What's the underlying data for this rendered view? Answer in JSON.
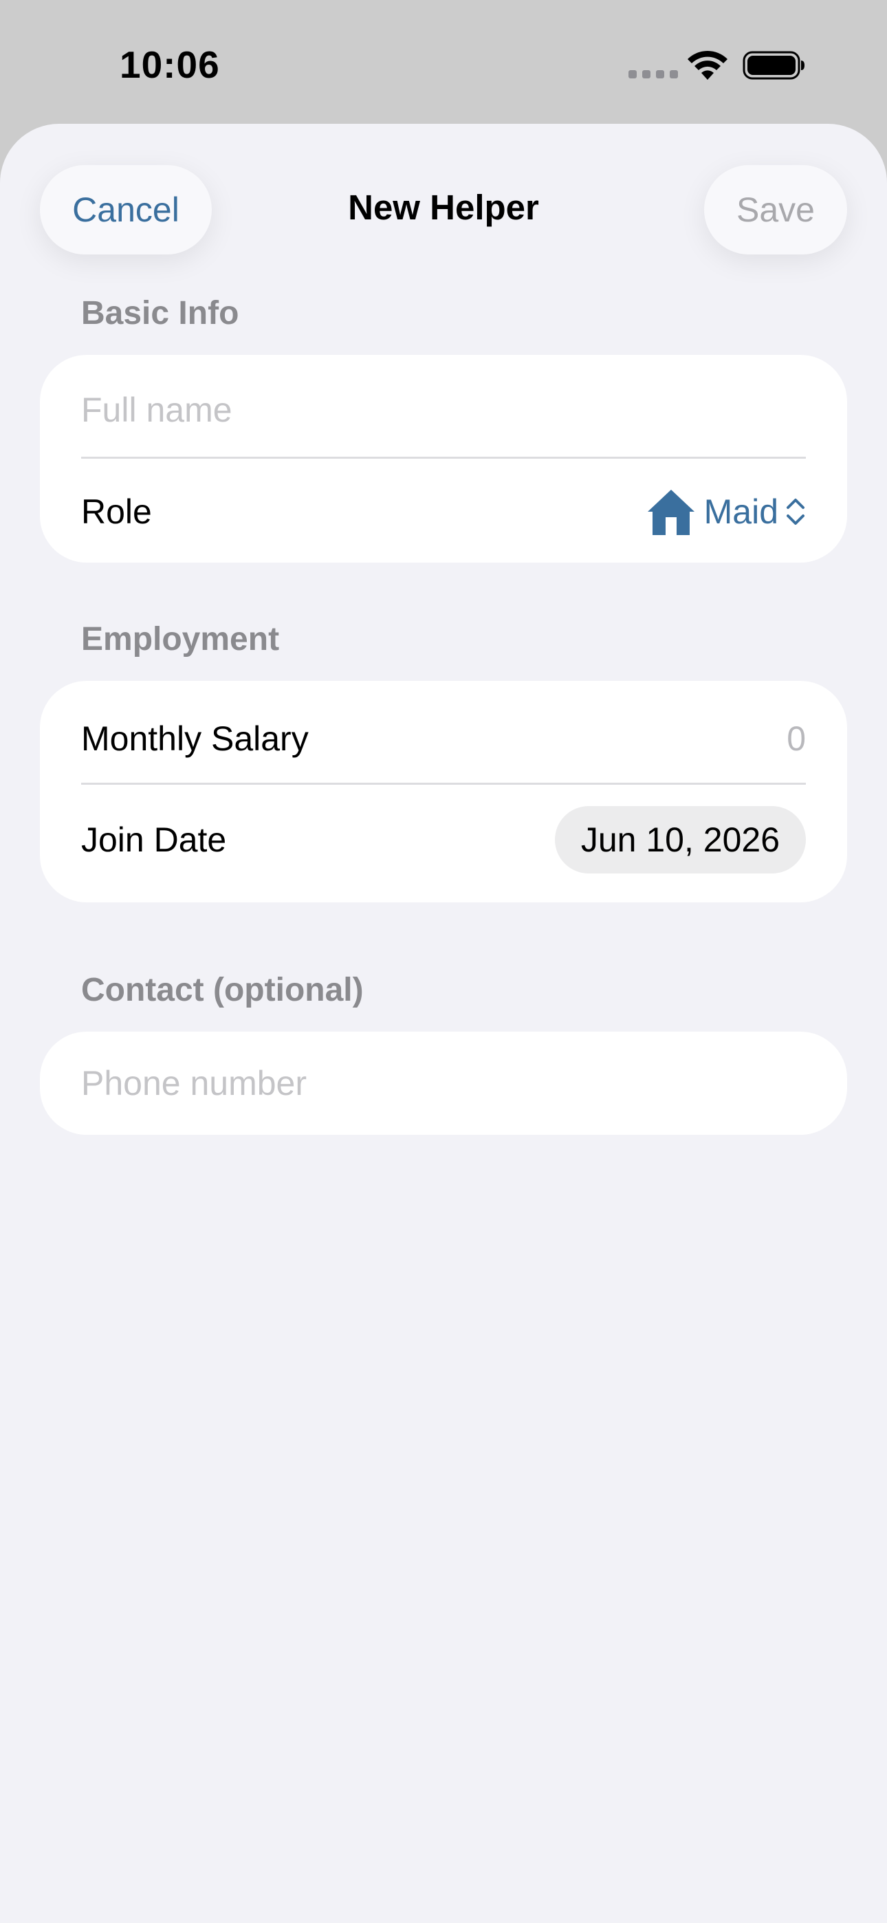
{
  "status_bar": {
    "time": "10:06",
    "signal_icon": "cellular-signal-icon",
    "wifi_icon": "wifi-icon",
    "battery_icon": "battery-full-icon"
  },
  "header": {
    "cancel_label": "Cancel",
    "title": "New Helper",
    "save_label": "Save"
  },
  "sections": {
    "basic_info": {
      "title": "Basic Info",
      "full_name_placeholder": "Full name",
      "role_label": "Role",
      "role_value": "Maid",
      "role_icon": "house-icon"
    },
    "employment": {
      "title": "Employment",
      "salary_label": "Monthly Salary",
      "salary_placeholder": "0",
      "join_date_label": "Join Date",
      "join_date_value": "Jun 10, 2026"
    },
    "contact": {
      "title": "Contact (optional)",
      "phone_placeholder": "Phone number"
    }
  },
  "colors": {
    "accent": "#3a6f9e",
    "background": "#f2f2f7",
    "card": "#ffffff",
    "secondary_text": "#8a8a8e",
    "placeholder": "#c4c4c7",
    "disabled": "#a8a8ac"
  }
}
